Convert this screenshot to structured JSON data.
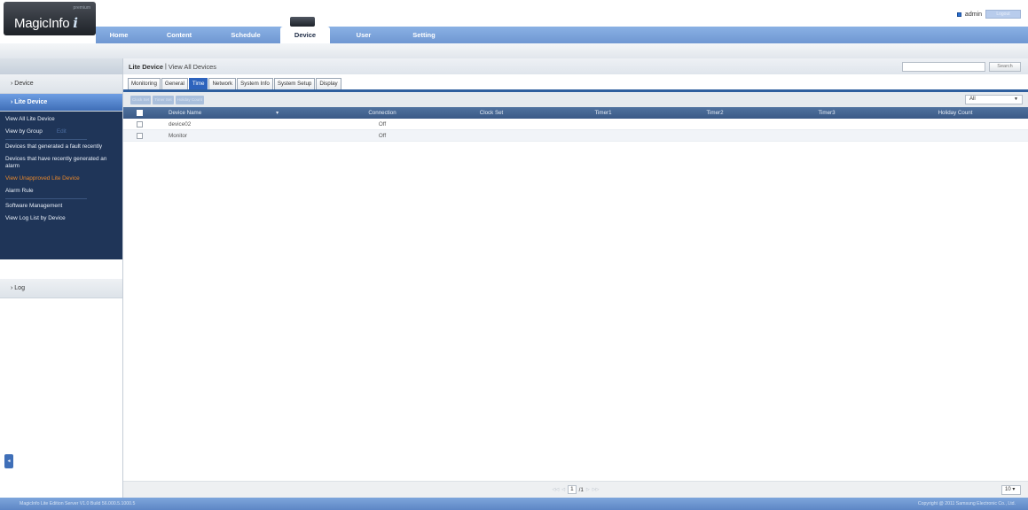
{
  "logo": {
    "tier": "premium",
    "brand": "MagicInfo",
    "brand_suffix": "i"
  },
  "nav": {
    "items": [
      "Home",
      "Content",
      "Schedule",
      "Device",
      "User",
      "Setting"
    ],
    "active": "Device"
  },
  "user": {
    "name": "admin",
    "logout": "Logout"
  },
  "sidebar": {
    "device_label": "Device",
    "lite_device_label": "Lite Device",
    "items": [
      {
        "label": "View All Lite Device"
      },
      {
        "label": "View by Group",
        "edit": "Edit"
      },
      {
        "label": "Devices that generated a fault recently"
      },
      {
        "label": "Devices that have recently generated an alarm"
      },
      {
        "label": "View Unapproved Lite Device"
      },
      {
        "label": "Alarm Rule"
      },
      {
        "label": "Software Management"
      },
      {
        "label": "View Log List by Device"
      }
    ],
    "log_label": "Log"
  },
  "titlebar": {
    "title": "Lite Device",
    "separator": "|",
    "subtitle": "View All Devices",
    "search_button": "Search",
    "search_value": ""
  },
  "tabs": [
    "Monitoring",
    "General",
    "Time",
    "Network",
    "System Info",
    "System Setup",
    "Display"
  ],
  "active_tab": "Time",
  "toolbar": {
    "buttons": [
      "Clock Set",
      "Timer Set",
      "Holiday Count"
    ],
    "filter_value": "All"
  },
  "table": {
    "columns": [
      "Device Name",
      "Connection",
      "Clock Set",
      "Timer1",
      "Timer2",
      "Timer3",
      "Holiday Count"
    ],
    "rows": [
      {
        "name": "device02",
        "connection": "Off"
      },
      {
        "name": "Monitor",
        "connection": "Off"
      }
    ]
  },
  "pager": {
    "current": "1",
    "total": "/1",
    "page_size": "10"
  },
  "footer": {
    "left": "MagicInfo Lite Edition Server V1.0 Build 56.000.5.1000.5",
    "right": "Copyright @ 2011 Samsung Electronic Co., Ltd."
  },
  "colors": {
    "accent": "#2d63bd",
    "sidebar_panel": "#1f3558",
    "highlight": "#e8872a"
  }
}
